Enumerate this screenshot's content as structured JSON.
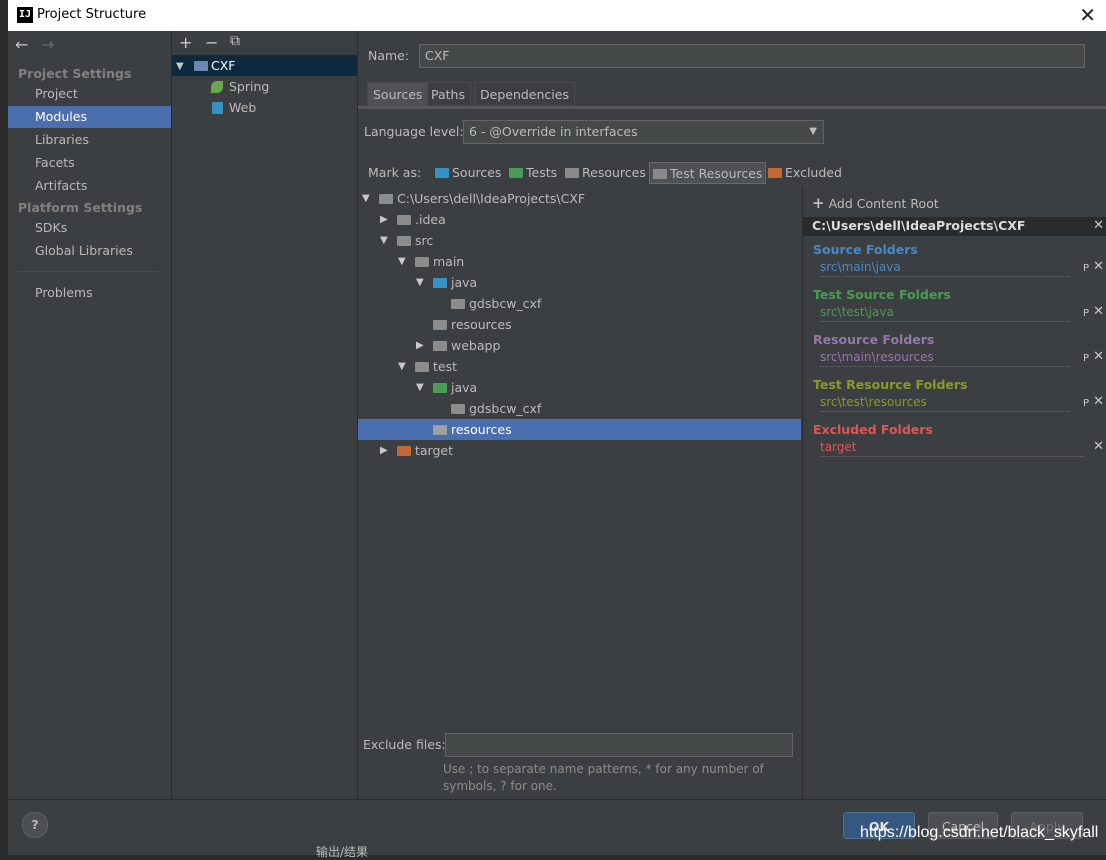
{
  "window": {
    "title": "Project Structure",
    "app_icon_text": "IJ",
    "close_glyph": "✕"
  },
  "nav": {
    "back": "←",
    "forward": "→"
  },
  "sidebar": {
    "project_settings_header": "Project Settings",
    "project_items": [
      "Project",
      "Modules",
      "Libraries",
      "Facets",
      "Artifacts"
    ],
    "selected": "Modules",
    "platform_settings_header": "Platform Settings",
    "platform_items": [
      "SDKs",
      "Global Libraries"
    ],
    "problems": "Problems"
  },
  "module_toolbar": {
    "add": "+",
    "remove": "−",
    "copy": "⧉"
  },
  "module_tree": [
    {
      "name": "CXF",
      "expanded": true,
      "selected": true
    },
    {
      "name": "Spring"
    },
    {
      "name": "Web"
    }
  ],
  "form": {
    "name_label": "Name:",
    "name_value": "CXF"
  },
  "tabs": [
    "Sources",
    "Paths",
    "Dependencies"
  ],
  "language": {
    "label": "Language level:",
    "value": "6 - @Override in interfaces"
  },
  "mark_as": {
    "label": "Mark as:",
    "items": [
      {
        "label": "Sources",
        "color": "#3592c4"
      },
      {
        "label": "Tests",
        "color": "#499c54"
      },
      {
        "label": "Resources",
        "color": "#8a8a8a"
      },
      {
        "label": "Test Resources",
        "color": "#8a8a8a",
        "selected": true
      },
      {
        "label": "Excluded",
        "color": "#c75450"
      }
    ]
  },
  "file_tree": [
    {
      "name": "C:\\Users\\dell\\IdeaProjects\\CXF",
      "toggle": "▼",
      "color": "#8c8c8c"
    },
    {
      "name": ".idea",
      "toggle": "▶",
      "color": "#8c8c8c"
    },
    {
      "name": "src",
      "toggle": "▼",
      "color": "#8c8c8c"
    },
    {
      "name": "main",
      "toggle": "▼",
      "color": "#8c8c8c"
    },
    {
      "name": "java",
      "toggle": "▼",
      "color": "#3592c4"
    },
    {
      "name": "gdsbcw_cxf",
      "toggle": "",
      "color": "#8c8c8c"
    },
    {
      "name": "resources",
      "toggle": "",
      "color": "#8c8c8c"
    },
    {
      "name": "webapp",
      "toggle": "▶",
      "color": "#8c8c8c"
    },
    {
      "name": "test",
      "toggle": "▼",
      "color": "#8c8c8c"
    },
    {
      "name": "java",
      "toggle": "▼",
      "color": "#499c54"
    },
    {
      "name": "gdsbcw_cxf",
      "toggle": "",
      "color": "#8c8c8c"
    },
    {
      "name": "resources",
      "toggle": "",
      "color": "#8c8c8c",
      "selected": true
    },
    {
      "name": "target",
      "toggle": "▶",
      "color": "#c16833"
    }
  ],
  "right_panel": {
    "add_content_root": "Add Content Root",
    "root_path": "C:\\Users\\dell\\IdeaProjects\\CXF",
    "categories": [
      {
        "title": "Source Folders",
        "path": "src\\main\\java",
        "color": "#4a88c7",
        "path_color": "#4a88c7",
        "has_props": true
      },
      {
        "title": "Test Source Folders",
        "path": "src\\test\\java",
        "color": "#499c54",
        "path_color": "#499c54",
        "has_props": true
      },
      {
        "title": "Resource Folders",
        "path": "src\\main\\resources",
        "color": "#9876aa",
        "path_color": "#9876aa",
        "has_props": true
      },
      {
        "title": "Test Resource Folders",
        "path": "src\\test\\resources",
        "color": "#8a9a2a",
        "path_color": "#8a9a2a",
        "has_props": true
      },
      {
        "title": "Excluded Folders",
        "path": "target",
        "color": "#e05555",
        "path_color": "#e05555",
        "has_props": false
      }
    ],
    "props_glyph": "P",
    "remove_glyph": "✕"
  },
  "exclude": {
    "label": "Exclude files:",
    "value": "",
    "hint_line1": "Use ; to separate name patterns, * for any number of",
    "hint_line2": "symbols, ? for one."
  },
  "buttons": {
    "help": "?",
    "ok": "OK",
    "cancel": "Cancel",
    "apply": "Apply"
  },
  "watermark": "https://blog.csdn.net/black_skyfall",
  "background_text": "输出/结果"
}
